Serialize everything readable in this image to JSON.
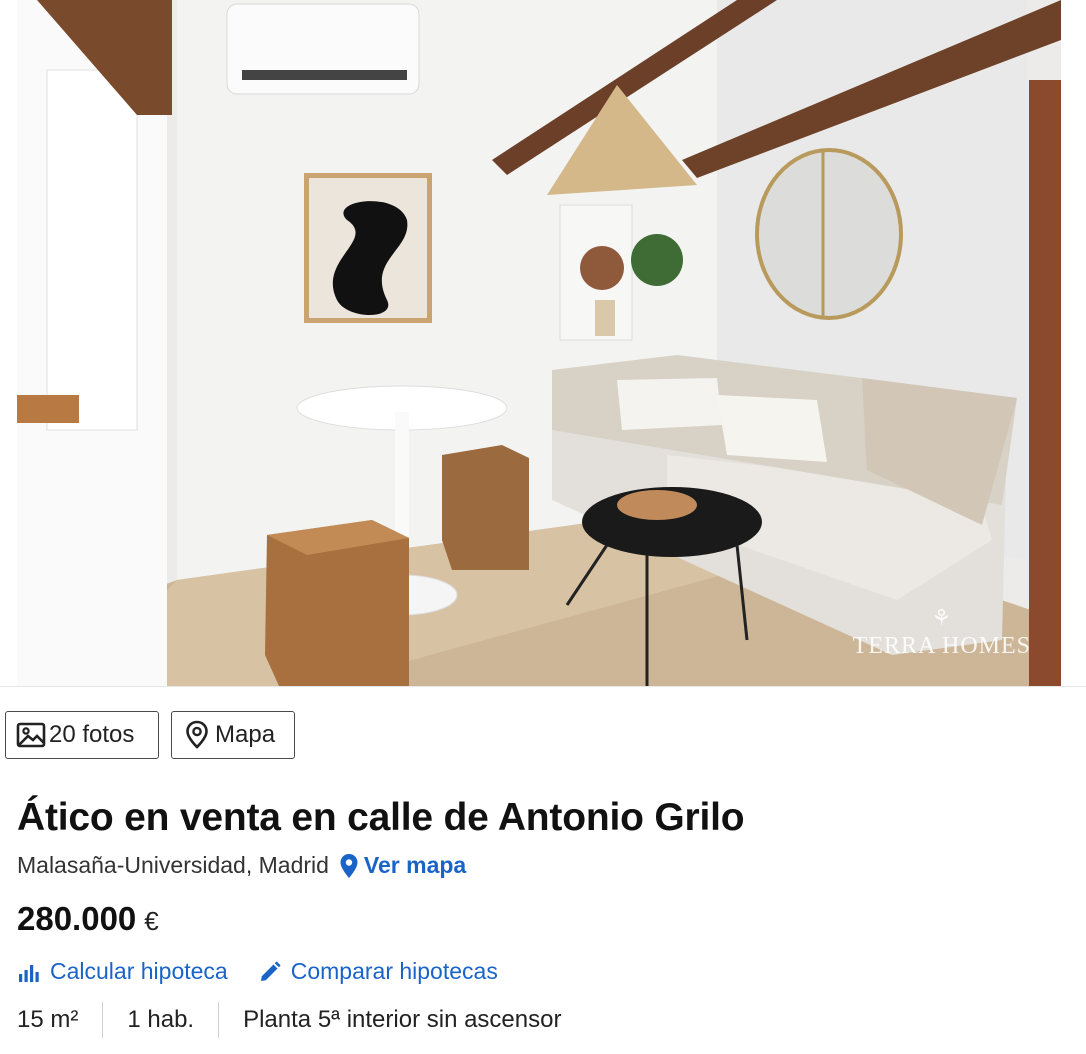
{
  "photo": {
    "alt_icon": "listing-photo",
    "watermark": "TERRA HOMES"
  },
  "buttons": {
    "photos_label": "20 fotos",
    "photos_icon": "image-icon",
    "map_label": "Mapa",
    "map_icon": "map-pin-icon"
  },
  "listing": {
    "title": "Ático en venta en calle de Antonio Grilo",
    "location": "Malasaña-Universidad, Madrid",
    "map_link": "Ver mapa",
    "price": "280.000",
    "currency": "€"
  },
  "actions": {
    "calc_label": "Calcular hipoteca",
    "compare_label": "Comparar hipotecas"
  },
  "features": [
    "15 m²",
    "1 hab.",
    "Planta 5ª interior sin ascensor"
  ],
  "colors": {
    "link": "#1a64c8",
    "text": "#222222"
  }
}
